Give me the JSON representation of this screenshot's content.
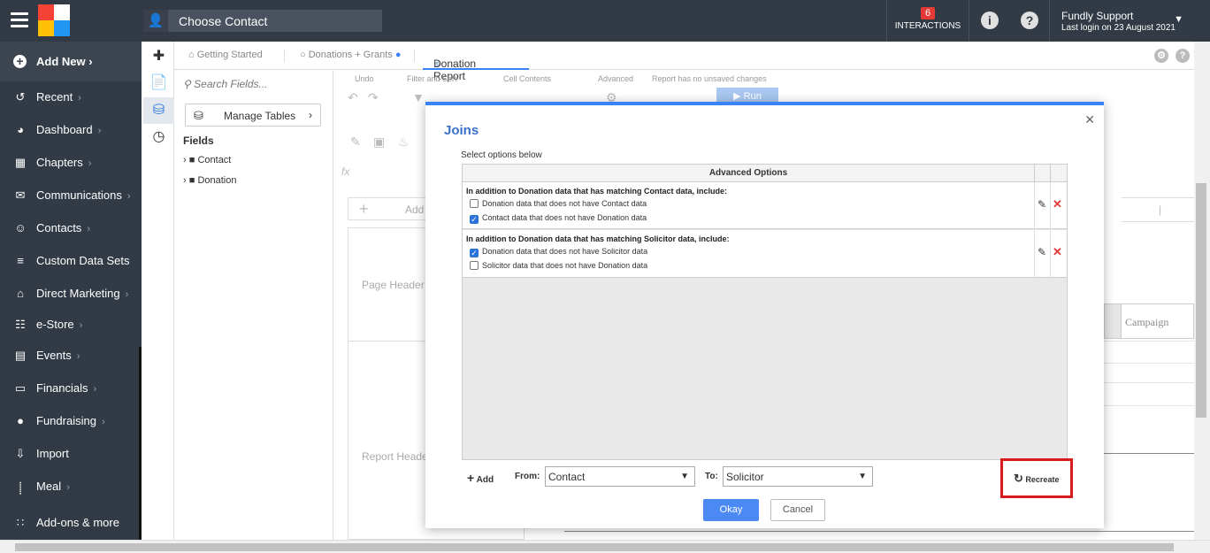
{
  "topbar": {
    "contact_label": "Choose Contact",
    "interactions_count": "6",
    "interactions_label": "INTERACTIONS",
    "user_name": "Fundly Support",
    "last_login": "Last login on 23 August 2021"
  },
  "sidebar": {
    "add_new": "Add New",
    "items": [
      {
        "label": "Recent",
        "icon": "history-icon",
        "chevron": true
      },
      {
        "label": "Dashboard",
        "icon": "dashboard-icon",
        "chevron": true
      },
      {
        "label": "Chapters",
        "icon": "grid-icon",
        "chevron": true
      },
      {
        "label": "Communications",
        "icon": "envelope-icon",
        "chevron": true
      },
      {
        "label": "Contacts",
        "icon": "person-icon",
        "chevron": true
      },
      {
        "label": "Custom Data Sets",
        "icon": "layers-icon",
        "chevron": false
      },
      {
        "label": "Direct Marketing",
        "icon": "bank-icon",
        "chevron": true
      },
      {
        "label": "e-Store",
        "icon": "cart-icon",
        "chevron": true
      },
      {
        "label": "Events",
        "icon": "calendar-icon",
        "chevron": true
      },
      {
        "label": "Financials",
        "icon": "money-icon",
        "chevron": true
      },
      {
        "label": "Fundraising",
        "icon": "moneybag-icon",
        "chevron": true
      },
      {
        "label": "Import",
        "icon": "import-icon",
        "chevron": false
      },
      {
        "label": "Meal",
        "icon": "cutlery-icon",
        "chevron": true
      },
      {
        "label": "Add-ons & more",
        "icon": "apps-icon",
        "chevron": false
      }
    ]
  },
  "tabs": {
    "getting_started": "Getting Started",
    "donations_grants": "Donations + Grants",
    "donation_report": "Donation Report"
  },
  "fields_panel": {
    "search_placeholder": "Search Fields...",
    "manage_tables": "Manage Tables",
    "title": "Fields",
    "tree": [
      "Contact",
      "Donation"
    ]
  },
  "ribbon": {
    "undo": "Undo",
    "filter_sort": "Filter and Sort",
    "cell_contents": "Cell Contents",
    "advanced": "Advanced",
    "unsaved": "Report has no unsaved changes",
    "run": "Run"
  },
  "background": {
    "add": "Add",
    "page_header": "Page Header",
    "report_header": "Report Heade",
    "campaign": "Campaign",
    "divider": "|"
  },
  "modal": {
    "title": "Joins",
    "subtitle": "Select options below",
    "table_header": "Advanced Options",
    "groups": [
      {
        "heading": "In addition to Donation data that has matching Contact data, include:",
        "options": [
          {
            "label": "Donation data that does not have Contact data",
            "checked": false
          },
          {
            "label": "Contact data that does not have Donation data",
            "checked": true
          }
        ]
      },
      {
        "heading": "In addition to Donation data that has matching Solicitor data, include:",
        "options": [
          {
            "label": "Donation data that does not have Solicitor data",
            "checked": true
          },
          {
            "label": "Solicitor data that does not have Donation data",
            "checked": false
          }
        ]
      }
    ],
    "add_label": "Add",
    "from_label": "From:",
    "from_value": "Contact",
    "to_label": "To:",
    "to_value": "Solicitor",
    "recreate": "Recreate",
    "okay": "Okay",
    "cancel": "Cancel"
  }
}
